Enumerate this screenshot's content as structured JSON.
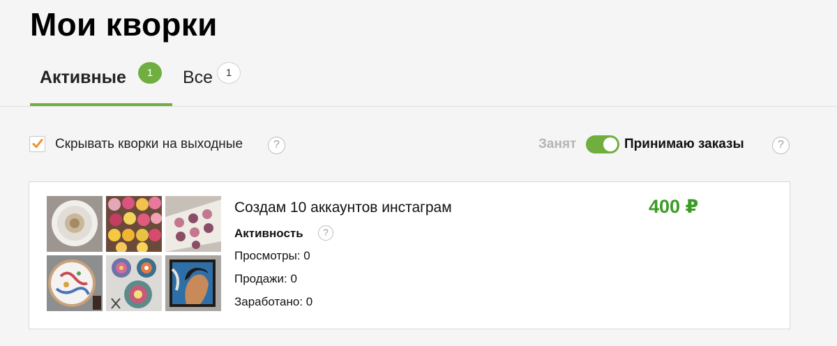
{
  "page": {
    "title": "Мои кворки"
  },
  "tabs": [
    {
      "label": "Активные",
      "count": "1",
      "active": true
    },
    {
      "label": "Все",
      "count": "1",
      "active": false
    }
  ],
  "options": {
    "hide_weekends_label": "Скрывать кворки на выходные",
    "hide_weekends_checked": true,
    "busy_label": "Занят",
    "accepting_label": "Принимаю заказы",
    "accepting_on": true,
    "help_glyph": "?"
  },
  "kwork": {
    "title": "Создам 10 аккаунтов инстаграм",
    "price": "400 ₽",
    "activity_label": "Активность",
    "views": "Просмотры: 0",
    "sales": "Продажи: 0",
    "earned": "Заработано: 0",
    "thumbnails": [
      "white-feather-wreath",
      "flower-cupcakes",
      "crochet-blanket",
      "embroidery-hoop",
      "mandala-stones",
      "portrait-painting"
    ]
  },
  "colors": {
    "accent_green": "#6fae3f",
    "price_green": "#3a9b27",
    "checkbox_orange": "#f0922b"
  }
}
